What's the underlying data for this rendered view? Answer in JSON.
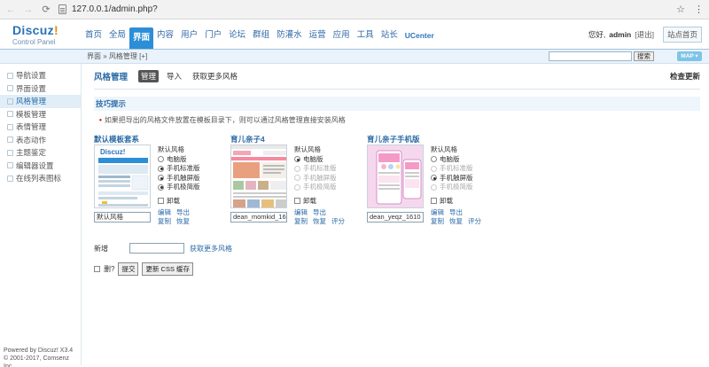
{
  "browser": {
    "url": "127.0.0.1/admin.php?"
  },
  "header": {
    "logo_main": "Discuz",
    "logo_mark": "!",
    "logo_sub": "Control Panel",
    "nav": [
      "首页",
      "全局",
      "界面",
      "内容",
      "用户",
      "门户",
      "论坛",
      "群组",
      "防灌水",
      "运营",
      "应用",
      "工具",
      "站长",
      "UCenter"
    ],
    "active_nav": 2,
    "greeting": "您好, ",
    "username": "admin",
    "logout": "[退出]",
    "home": "站点首页"
  },
  "subbar": {
    "breadcrumb": "界面 » 风格管理  [+]",
    "search_btn": "搜索",
    "map": "MAP ▾"
  },
  "sidebar": {
    "items": [
      "导航设置",
      "界面设置",
      "风格管理",
      "模板管理",
      "表情管理",
      "表态动作",
      "主题鉴定",
      "编辑器设置",
      "在线列表图标"
    ],
    "active": 2,
    "footer_line1": "Powered by Discuz! X3.4",
    "footer_line2": "© 2001-2017, Comsenz Inc."
  },
  "main": {
    "title": "风格管理",
    "tabs": [
      "管理",
      "导入",
      "获取更多风格"
    ],
    "check_update": "检查更新",
    "tips_title": "技巧提示",
    "tip_text": "如果把导出的风格文件放置在模板目录下，则可以通过风格管理直接安装风格",
    "styles": [
      {
        "name": "默认模板套系",
        "default_label": "默认风格",
        "options": [
          "电脑版",
          "手机标准版",
          "手机触屏版",
          "手机极简版"
        ],
        "selected": [
          1,
          2,
          3
        ],
        "disabled": [],
        "uninstall": "卸载",
        "input": "默认风格",
        "links": [
          "编辑",
          "导出",
          "",
          "复制",
          "恢复",
          ""
        ]
      },
      {
        "name": "育儿亲子4",
        "default_label": "默认风格",
        "options": [
          "电脑版",
          "手机标准版",
          "手机触屏版",
          "手机极简版"
        ],
        "selected": [
          0
        ],
        "disabled": [
          1,
          2,
          3
        ],
        "uninstall": "卸载",
        "input": "dean_momkid_16",
        "links": [
          "编辑",
          "导出",
          "",
          "复制",
          "恢复",
          "评分"
        ]
      },
      {
        "name": "育儿亲子手机版",
        "default_label": "默认风格",
        "options": [
          "电脑版",
          "手机标准版",
          "手机触屏版",
          "手机极简版"
        ],
        "selected": [
          2
        ],
        "disabled": [
          1,
          3
        ],
        "uninstall": "卸载",
        "input": "dean_yeqz_1610",
        "links": [
          "编辑",
          "导出",
          "",
          "复制",
          "恢复",
          "评分"
        ]
      }
    ],
    "new_label": "新增",
    "more_styles": "获取更多风格",
    "delete_label": "删?",
    "submit": "提交",
    "update_css": "更新 CSS 缓存"
  },
  "colors": {
    "accent": "#2d8ed8",
    "link": "#2a6aa6"
  }
}
